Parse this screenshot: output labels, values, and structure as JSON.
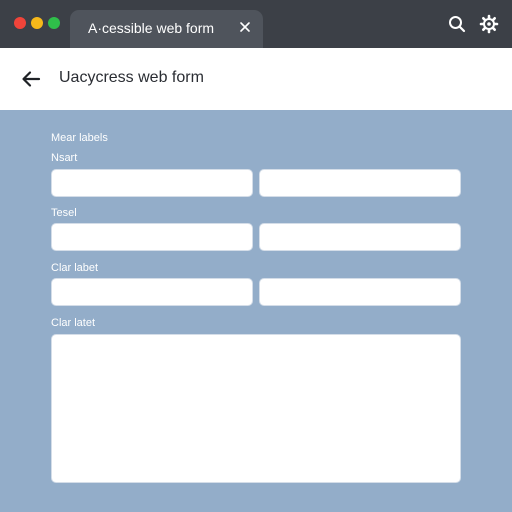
{
  "window": {
    "tab_title": "A·cessible web form"
  },
  "header": {
    "title": "Uacycress web form"
  },
  "form": {
    "group_label": "Mear labels",
    "fields": [
      {
        "label": "Nsart"
      },
      {
        "label": "Tesel"
      },
      {
        "label": "Clar labet"
      },
      {
        "label": "Clar latet"
      }
    ]
  },
  "icons": {
    "back": "arrow-left-icon",
    "search": "search-icon",
    "settings": "gear-icon",
    "close": "close-icon"
  },
  "colors": {
    "titlebar": "#3c4047",
    "tab": "#4f545c",
    "panel": "#93adc9",
    "window_red": "#f0443a",
    "window_yellow": "#f6b81a",
    "window_green": "#2fbf4a"
  }
}
